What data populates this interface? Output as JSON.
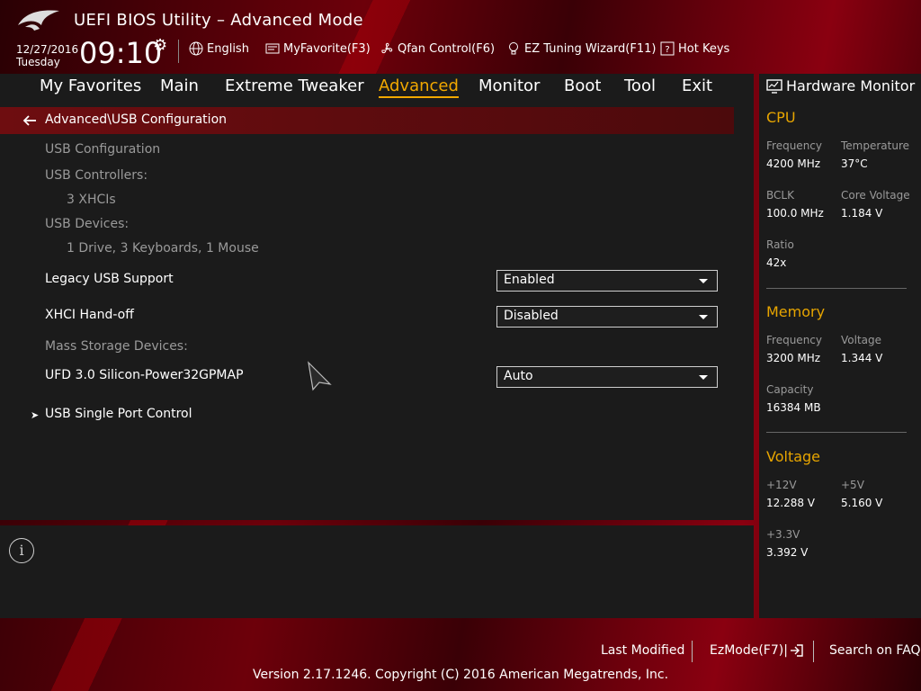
{
  "header": {
    "title": "UEFI BIOS Utility – Advanced Mode",
    "date": "12/27/2016",
    "weekday": "Tuesday",
    "time": "09:10",
    "toolbar": {
      "language": "English",
      "my_favorite": "MyFavorite(F3)",
      "qfan": "Qfan Control(F6)",
      "ez_tuning": "EZ Tuning Wizard(F11)",
      "hot_keys": "Hot Keys"
    }
  },
  "nav": {
    "tabs": [
      "My Favorites",
      "Main",
      "Extreme Tweaker",
      "Advanced",
      "Monitor",
      "Boot",
      "Tool",
      "Exit"
    ],
    "active": "Advanced"
  },
  "breadcrumb": "Advanced\\USB Configuration",
  "content": {
    "section_title": "USB Configuration",
    "controllers_label": "USB Controllers:",
    "controllers_value": "3 XHCIs",
    "devices_label": "USB Devices:",
    "devices_value": "1 Drive, 3 Keyboards, 1 Mouse",
    "legacy_label": "Legacy USB Support",
    "legacy_value": "Enabled",
    "xhci_label": "XHCI Hand-off",
    "xhci_value": "Disabled",
    "mass_storage_label": "Mass Storage Devices:",
    "ufd_label": "UFD 3.0 Silicon-Power32GPMAP",
    "ufd_value": "Auto",
    "single_port_label": "USB Single Port Control"
  },
  "hardware_monitor": {
    "title": "Hardware Monitor",
    "cpu": {
      "heading": "CPU",
      "frequency_label": "Frequency",
      "frequency_value": "4200 MHz",
      "temperature_label": "Temperature",
      "temperature_value": "37°C",
      "bclk_label": "BCLK",
      "bclk_value": "100.0 MHz",
      "core_voltage_label": "Core Voltage",
      "core_voltage_value": "1.184 V",
      "ratio_label": "Ratio",
      "ratio_value": "42x"
    },
    "memory": {
      "heading": "Memory",
      "frequency_label": "Frequency",
      "frequency_value": "3200 MHz",
      "voltage_label": "Voltage",
      "voltage_value": "1.344 V",
      "capacity_label": "Capacity",
      "capacity_value": "16384 MB"
    },
    "voltage": {
      "heading": "Voltage",
      "v12_label": "+12V",
      "v12_value": "12.288 V",
      "v5_label": "+5V",
      "v5_value": "5.160 V",
      "v33_label": "+3.3V",
      "v33_value": "3.392 V"
    }
  },
  "footer": {
    "last_modified": "Last Modified",
    "ez_mode": "EzMode(F7)|",
    "search_faq": "Search on FAQ",
    "copyright": "Version 2.17.1246. Copyright (C) 2016 American Megatrends, Inc."
  },
  "colors": {
    "accent": "#f2a800",
    "section_heading": "#e7a500",
    "breadcrumb_bg": "#6e0d10",
    "panel_bg": "#1b1b1b"
  }
}
